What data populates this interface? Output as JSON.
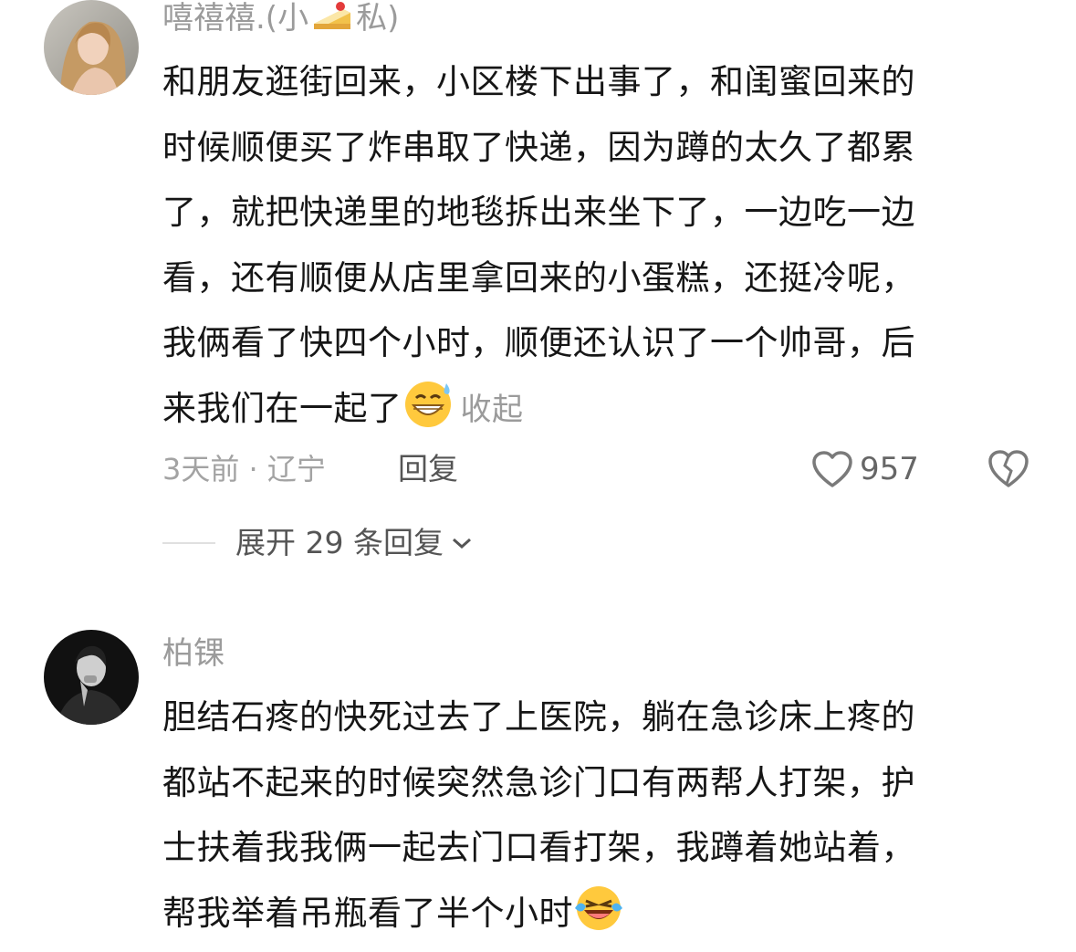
{
  "comments": [
    {
      "username_text": "嘻禧禧.(小",
      "username_suffix": "私)",
      "username_emoji": "cake-icon",
      "lines": [
        "和朋友逛街回来，小区楼下出事了，和闺蜜回来的",
        "时候顺便买了炸串取了快递，因为蹲的太久了都累",
        "了，就把快递里的地毯拆出来坐下了，一边吃一边",
        "看，还有顺便从店里拿回来的小蛋糕，还挺冷呢，",
        "我俩看了快四个小时，顺便还认识了一个帅哥，后",
        "来我们在一起了"
      ],
      "end_emoji": "grinning-sweat-emoji",
      "collapse": "收起",
      "time_location": "3天前 · 辽宁",
      "reply": "回复",
      "likes": "957",
      "expand_replies": "展开 29 条回复"
    },
    {
      "username": "柏锞",
      "lines": [
        "胆结石疼的快死过去了上医院，躺在急诊床上疼的",
        "都站不起来的时候突然急诊门口有两帮人打架，护",
        "士扶着我我俩一起去门口看打架，我蹲着她站着，",
        "帮我举着吊瓶看了半个小时"
      ],
      "end_emoji": "laughing-tears-emoji"
    }
  ],
  "colors": {
    "muted_text": "#9b9b9b",
    "body_text": "#161616",
    "action_text": "#555555"
  }
}
